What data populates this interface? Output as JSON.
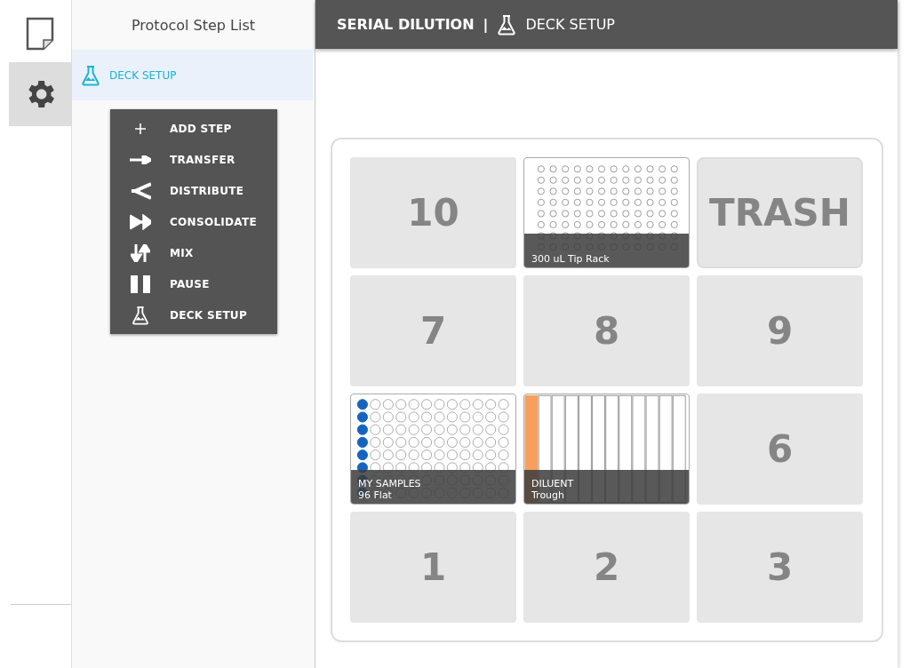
{
  "nav": [
    {
      "kind": "file",
      "selected": false
    },
    {
      "kind": "settings",
      "selected": true
    }
  ],
  "sidebar": {
    "title": "Protocol Step List",
    "steps": [
      {
        "label": "DECK SETUP",
        "selected": true
      }
    ]
  },
  "add_step_menu": [
    {
      "kind": "add",
      "label": "ADD STEP"
    },
    {
      "kind": "transfer",
      "label": "TRANSFER"
    },
    {
      "kind": "distribute",
      "label": "DISTRIBUTE"
    },
    {
      "kind": "consolidate",
      "label": "CONSOLIDATE"
    },
    {
      "kind": "mix",
      "label": "MIX"
    },
    {
      "kind": "pause",
      "label": "PAUSE"
    },
    {
      "kind": "deck",
      "label": "DECK SETUP"
    }
  ],
  "header": {
    "protocol": "SERIAL DILUTION",
    "separator": "|",
    "page": "DECK SETUP"
  },
  "deck": [
    {
      "kind": "empty",
      "label": "10"
    },
    {
      "kind": "tiprack",
      "name": "300 uL Tip Rack"
    },
    {
      "kind": "trash",
      "label": "TRASH"
    },
    {
      "kind": "empty",
      "label": "7"
    },
    {
      "kind": "empty",
      "label": "8"
    },
    {
      "kind": "empty",
      "label": "9"
    },
    {
      "kind": "plate",
      "name": "MY SAMPLES",
      "type": "96 Flat",
      "color": "#1565c0",
      "filled_columns": [
        true,
        false,
        false,
        false,
        false,
        false,
        false,
        false,
        false,
        false,
        false,
        false
      ]
    },
    {
      "kind": "trough",
      "name": "DILUENT",
      "type": "Trough",
      "color": "#f7a05e",
      "filled_columns": [
        true,
        false,
        false,
        false,
        false,
        false,
        false,
        false,
        false,
        false,
        false,
        false
      ]
    },
    {
      "kind": "empty",
      "label": "6"
    },
    {
      "kind": "empty",
      "label": "1"
    },
    {
      "kind": "empty",
      "label": "2"
    },
    {
      "kind": "empty",
      "label": "3"
    }
  ]
}
